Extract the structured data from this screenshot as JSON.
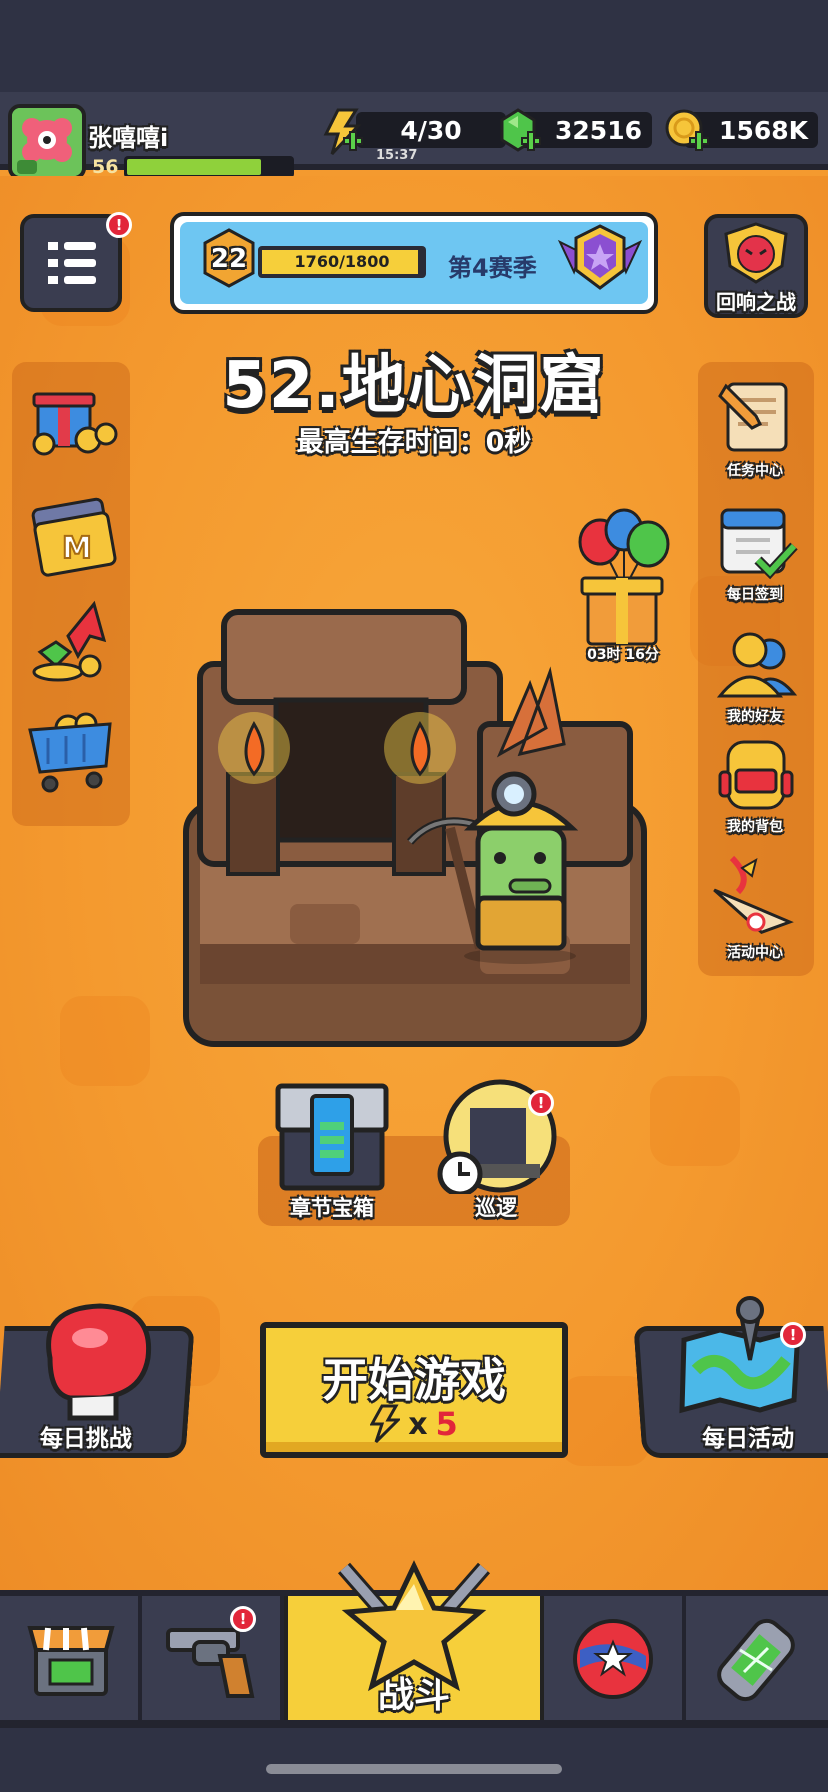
{
  "player": {
    "name": "张嘻嘻i",
    "level": "56",
    "xp_fraction": 0.82
  },
  "resources": {
    "energy": "4/30",
    "energy_timer": "15:37",
    "gems": "32516",
    "gold": "1568K"
  },
  "season": {
    "level": "22",
    "progress_text": "1760/1800",
    "progress_fraction": 0.978,
    "label": "第4赛季"
  },
  "echo_battle": {
    "label": "回响之战"
  },
  "stage": {
    "title": "52.地心洞窟",
    "best_time": "最高生存时间：0秒"
  },
  "right_menu": [
    {
      "label": "任务中心"
    },
    {
      "label": "每日签到"
    },
    {
      "label": "我的好友"
    },
    {
      "label": "我的背包"
    },
    {
      "label": "活动中心"
    }
  ],
  "gift": {
    "timer": "03时 16分"
  },
  "chapter_chest": {
    "label": "章节宝箱"
  },
  "patrol": {
    "label": "巡逻"
  },
  "daily_challenge": {
    "label": "每日挑战"
  },
  "start": {
    "label": "开始游戏",
    "cost_prefix": "x",
    "cost": "5"
  },
  "daily_activity": {
    "label": "每日活动"
  },
  "nav": {
    "battle_label": "战斗"
  },
  "badge_mark": "!",
  "colors": {
    "accent_yellow": "#f6cf3a",
    "bg_orange": "#f49a2f",
    "dark_panel": "#3a3d50",
    "gem_green": "#4fc54a",
    "alert_red": "#e2263a"
  }
}
